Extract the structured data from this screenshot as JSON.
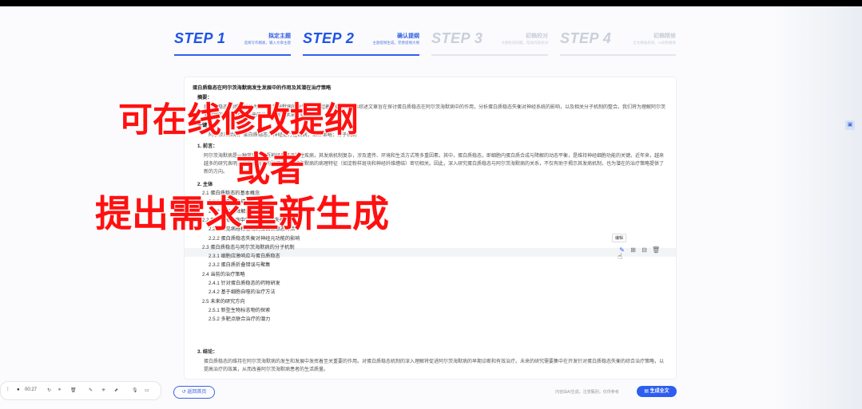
{
  "steps": [
    {
      "num": "STEP 1",
      "title": "拟定主题",
      "sub": "选择写作模板，输入文章主题"
    },
    {
      "num": "STEP 2",
      "title": "确认提纲",
      "sub": "主题提纲生成，完善提纲大纲"
    },
    {
      "num": "STEP 3",
      "title": "初稿校对",
      "sub": "大纲生成初稿，帮助内容校对"
    },
    {
      "num": "STEP 4",
      "title": "初稿精修",
      "sub": "全文精准校修，AI润色精修"
    }
  ],
  "doc": {
    "title": "蛋白质稳态在阿尔茨海默病发生发展中的作用及其潜在治疗策略",
    "abstract_label": "摘要：",
    "abstract_text": "蛋白质稳态(的维持被认为在阿尔茨海默病的发生发展中起着关键作用。本综述文章旨在探讨蛋白质稳态在阿尔茨海默病中的作用，分析蛋白质稳态失衡对神经系统的影响，以及相关分子机制的整合。我们将为理解阿尔茨海默病的病理机制和未来的治疗方案提供深刻见解。",
    "keywords_label": "关键词：",
    "keywords_text": "阿尔茨海默病；蛋白质稳态；神经退行性疾病；治疗策略；分子机制",
    "sec1": "1. 前言：",
    "sec1_text": "阿尔茨海默病是一种常见的中枢神经系统退行性疾病，其发病机制复杂，涉及遗传、环境和生活方式等多重因素。其中，蛋白质稳态，即细胞内蛋白质合成与降解的动态平衡，是维持神经细胞功能的关键。近年来，越来越多的研究表明，蛋白质稳态的破坏与阿尔茨海默病的病理特征（如淀粉样斑块和神经纤维缠结）密切相关。因此，深入研究蛋白质稳态与阿尔茨海默病的关系，不仅有助于揭示其发病机制，也为潜在的治疗策略提供了新的方向。",
    "sec2": "2. 主体",
    "outline": [
      "2.1 蛋白质稳态的基本概念",
      "2.1.1 蛋白质合成与折叠",
      "2.1.2 蛋白质降解途径",
      "2.2 阿尔茨海默病中的蛋白质稳态失衡",
      "2.2.1 常见病理标志物的蛋白质稳态特点",
      "2.2.2 蛋白质稳态失衡对神经元功能的影响",
      "2.3 蛋白质稳态与阿尔茨海默病的分子机制",
      "2.3.1 细胞应激响应与蛋白质稳态",
      "2.3.2 蛋白质折叠错误与聚集",
      "2.4 当前的治疗策略",
      "2.4.1 针对蛋白质稳态的药物研发",
      "2.4.2 基于细胞自噬的治疗方法",
      "2.5 未来的研究方向",
      "2.5.1 新型生物标志物的探索",
      "2.5.2 多靶点联合治疗的潜力"
    ],
    "sec3": "3. 结论：",
    "sec3_text": "蛋白质稳态的维持在阿尔茨海默病的发生和发展中发挥着至关重要的作用。对蛋白质稳态机制的深入理解将促进阿尔茨海默病的早期诊断和有效治疗。未来的研究需要集中在开发针对蛋白质稳态失衡的综合治疗策略，以提高治疗的效果，从而改善阿尔茨海默病患者的生活质量。"
  },
  "tooltip": "编辑",
  "overlay": {
    "line1": "可在线修改提纲",
    "line2": "或者",
    "line3": "提出需求重新生成"
  },
  "bottom": {
    "back": "返回首页",
    "hint": "内容由AI生成，注意甄别，仅供参考",
    "generate": "生成全文"
  },
  "recorder": {
    "time": "00:27"
  }
}
